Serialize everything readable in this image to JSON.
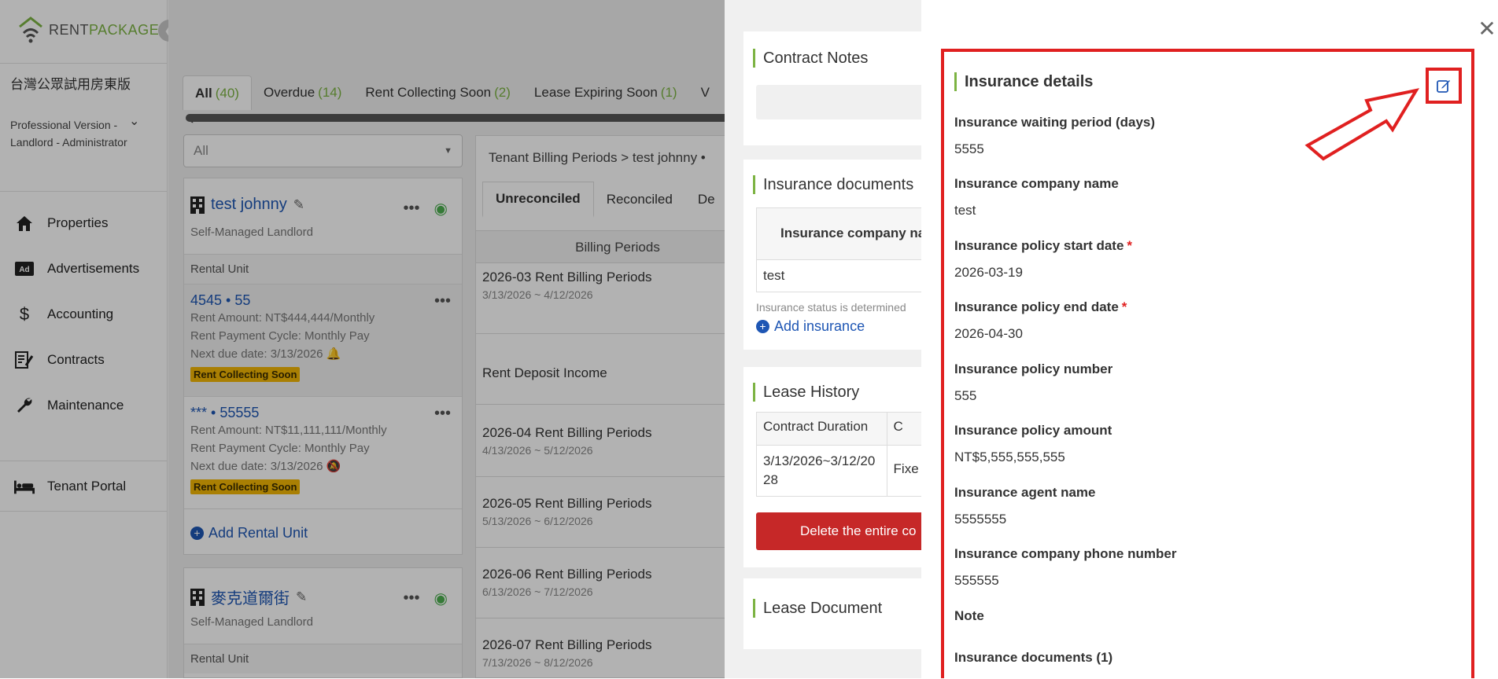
{
  "brand": {
    "part1": "RENT",
    "part2": "PACKAGE"
  },
  "sidebar": {
    "org_name": "台灣公眾試用房東版",
    "org_role": "Professional Version - Landlord - Administrator",
    "nav": [
      {
        "label": "Properties",
        "icon": "home-icon"
      },
      {
        "label": "Advertisements",
        "icon": "ad-icon"
      },
      {
        "label": "Accounting",
        "icon": "dollar-icon"
      },
      {
        "label": "Contracts",
        "icon": "contract-icon"
      },
      {
        "label": "Maintenance",
        "icon": "wrench-icon"
      },
      {
        "label": "Tenant Portal",
        "icon": "bed-icon"
      }
    ]
  },
  "tabs": [
    {
      "label": "All",
      "count": "(40)"
    },
    {
      "label": "Overdue",
      "count": "(14)"
    },
    {
      "label": "Rent Collecting Soon",
      "count": "(2)"
    },
    {
      "label": "Lease Expiring Soon",
      "count": "(1)"
    },
    {
      "label": "V",
      "count": ""
    }
  ],
  "filter": {
    "value": "All"
  },
  "properties": [
    {
      "name": "test johnny",
      "type": "Self-Managed Landlord",
      "rental_label": "Rental Unit",
      "units": [
        {
          "title": "4545 • 55",
          "rent": "Rent Amount: NT$444,444/Monthly",
          "cycle": "Rent Payment Cycle: Monthly Pay",
          "due": "Next due date:  3/13/2026",
          "badge": "Rent Collecting Soon"
        },
        {
          "title": "*** • 55555",
          "rent": "Rent Amount: NT$11,111,111/Monthly",
          "cycle": "Rent Payment Cycle: Monthly Pay",
          "due": "Next due date:  3/13/2026",
          "badge": "Rent Collecting Soon"
        }
      ],
      "add_unit": "Add Rental Unit"
    },
    {
      "name": "麥克道爾街",
      "type": "Self-Managed Landlord",
      "rental_label": "Rental Unit"
    }
  ],
  "billing": {
    "crumb": "Tenant Billing Periods >  test johnny •",
    "tabs": [
      "Unreconciled",
      "Reconciled",
      "De"
    ],
    "column": "Billing Periods",
    "rows": [
      {
        "title": "2026-03 Rent Billing Periods",
        "date": "3/13/2026 ~ 4/12/2026"
      },
      {
        "title": "Rent Deposit Income",
        "date": ""
      },
      {
        "title": "2026-04 Rent Billing Periods",
        "date": "4/13/2026 ~ 5/12/2026"
      },
      {
        "title": "2026-05 Rent Billing Periods",
        "date": "5/13/2026 ~ 6/12/2026"
      },
      {
        "title": "2026-06 Rent Billing Periods",
        "date": "6/13/2026 ~ 7/12/2026"
      },
      {
        "title": "2026-07 Rent Billing Periods",
        "date": "7/13/2026 ~ 8/12/2026"
      }
    ]
  },
  "contract": {
    "notes_title": "Contract Notes",
    "insurance_docs_title": "Insurance documents",
    "ins_table_header": "Insurance company na",
    "ins_table_value": "test",
    "ins_status_note": "Insurance status is determined",
    "add_insurance": "Add insurance",
    "lease_history_title": "Lease History",
    "lh_col1": "Contract Duration",
    "lh_col2": "C",
    "lh_val1": "3/13/2026~3/12/2028",
    "lh_val2": "Fixe",
    "delete_label": "Delete the entire co",
    "lease_doc_title": "Lease Document"
  },
  "insurance": {
    "title": "Insurance details",
    "fields": [
      {
        "label": "Insurance waiting period (days)",
        "value": "5555",
        "required": ""
      },
      {
        "label": "Insurance company name",
        "value": "test",
        "required": ""
      },
      {
        "label": "Insurance policy start date",
        "value": "2026-03-19",
        "required": "*"
      },
      {
        "label": "Insurance policy end date",
        "value": "2026-04-30",
        "required": "*"
      },
      {
        "label": "Insurance policy number",
        "value": "555",
        "required": ""
      },
      {
        "label": "Insurance policy amount",
        "value": "NT$5,555,555,555",
        "required": ""
      },
      {
        "label": "Insurance agent name",
        "value": "5555555",
        "required": ""
      },
      {
        "label": "Insurance company phone number",
        "value": "555555",
        "required": ""
      },
      {
        "label": "Note",
        "value": "",
        "required": ""
      },
      {
        "label": "Insurance documents (1)",
        "value": "",
        "required": ""
      }
    ]
  },
  "colors": {
    "brand_green": "#7cb342",
    "link_blue": "#1e56b4",
    "highlight_red": "#e02020",
    "badge_yellow": "#f2b705",
    "danger": "#c62828"
  }
}
